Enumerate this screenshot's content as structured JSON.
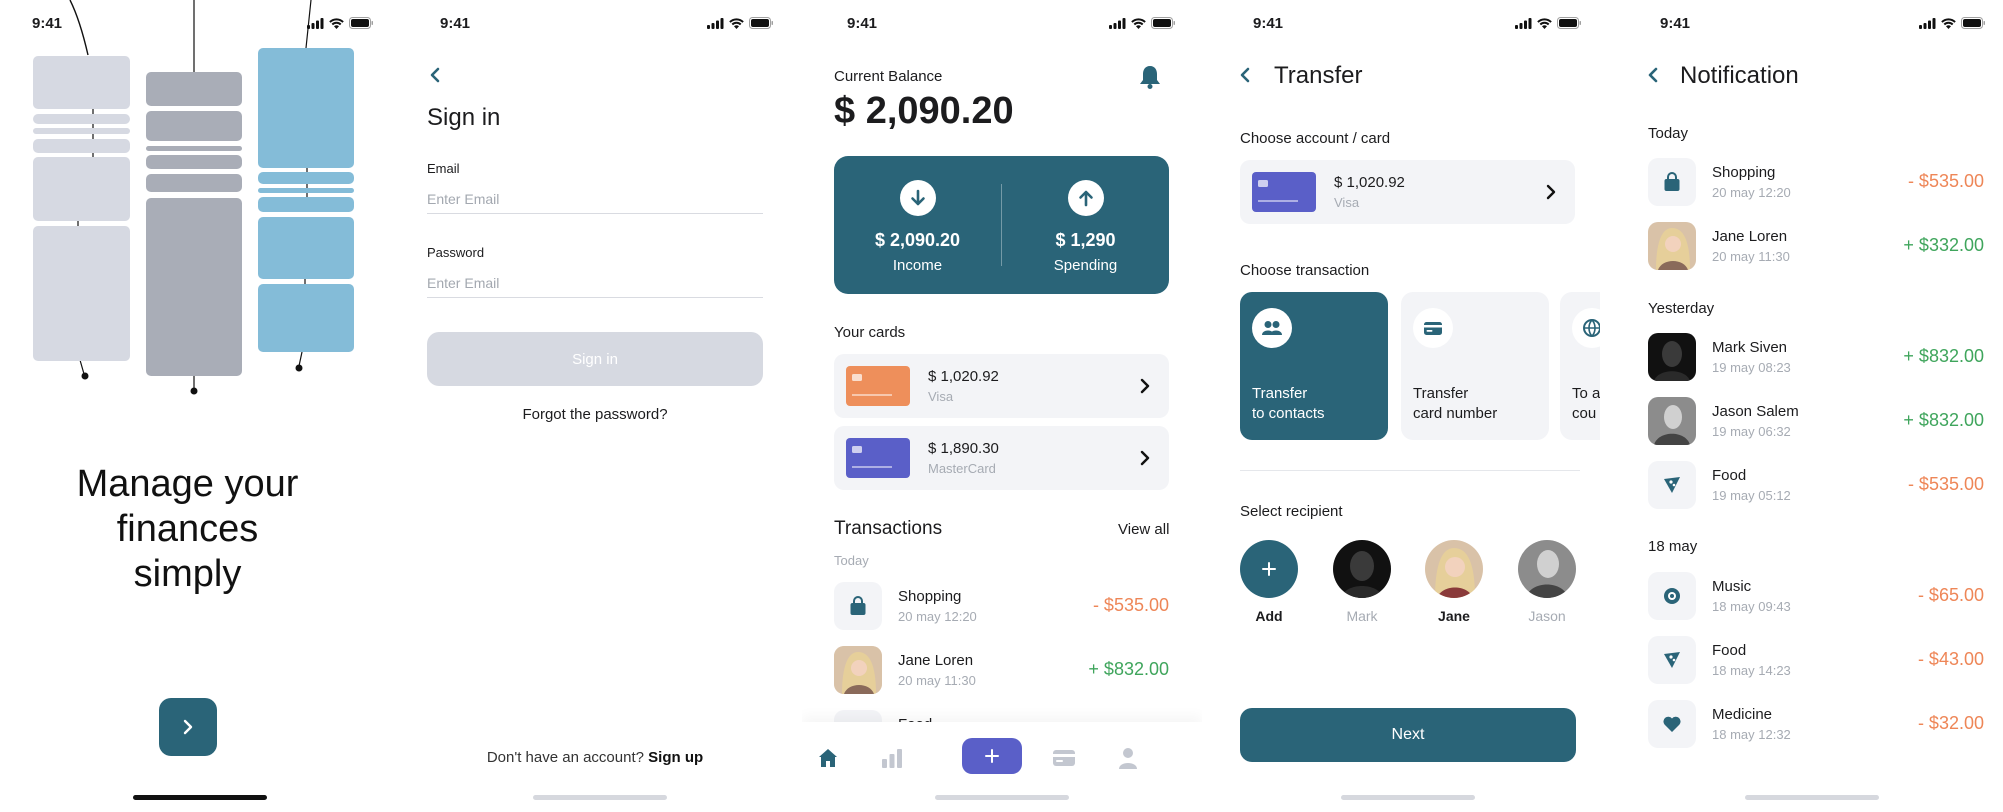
{
  "status_time": "9:41",
  "colors": {
    "primary": "#2a6478",
    "accent": "#5a5fc8",
    "negative": "#ee8657",
    "positive": "#3fa55c",
    "muted": "#a6abb3"
  },
  "onboarding": {
    "title_line1": "Manage your",
    "title_line2": "finances",
    "title_line3": "simply",
    "next_icon": "chevron-right-icon"
  },
  "signin": {
    "title": "Sign in",
    "email_label": "Email",
    "email_placeholder": "Enter Email",
    "password_label": "Password",
    "password_placeholder": "Enter Email",
    "button": "Sign in",
    "forgot": "Forgot the password?",
    "no_account": "Don't have an account?",
    "signup": "Sign up"
  },
  "home": {
    "balance_label": "Current Balance",
    "balance": "$ 2,090.20",
    "income_amount": "$ 2,090.20",
    "income_label": "Income",
    "spending_amount": "$ 1,290",
    "spending_label": "Spending",
    "cards_title": "Your cards",
    "cards": [
      {
        "amount": "$ 1,020.92",
        "type": "Visa"
      },
      {
        "amount": "$ 1,890.30",
        "type": "MasterCard"
      }
    ],
    "transactions_title": "Transactions",
    "view_all": "View all",
    "today_label": "Today",
    "transactions": [
      {
        "name": "Shopping",
        "date": "20 may 12:20",
        "value": "- $535.00"
      },
      {
        "name": "Jane Loren",
        "date": "20 may 11:30",
        "value": "+ $832.00"
      },
      {
        "name": "Food",
        "date": "",
        "value": ""
      }
    ]
  },
  "transfer": {
    "title": "Transfer",
    "choose_account": "Choose account / card",
    "account_amount": "$ 1,020.92",
    "account_type": "Visa",
    "choose_transaction": "Choose transaction",
    "options": [
      {
        "line1": "Transfer",
        "line2": "to contacts"
      },
      {
        "line1": "Transfer",
        "line2": "card number"
      },
      {
        "line1": "To a",
        "line2": "cou"
      }
    ],
    "select_recipient": "Select recipient",
    "recipients": [
      "Add",
      "Mark",
      "Jane",
      "Jason"
    ],
    "next": "Next"
  },
  "notification": {
    "title": "Notification",
    "groups": [
      {
        "label": "Today",
        "items": [
          {
            "name": "Shopping",
            "date": "20 may 12:20",
            "value": "- $535.00"
          },
          {
            "name": "Jane Loren",
            "date": "20 may 11:30",
            "value": "+ $332.00"
          }
        ]
      },
      {
        "label": "Yesterday",
        "items": [
          {
            "name": "Mark Siven",
            "date": "19 may 08:23",
            "value": "+ $832.00"
          },
          {
            "name": "Jason Salem",
            "date": "19 may 06:32",
            "value": "+ $832.00"
          },
          {
            "name": "Food",
            "date": "19 may 05:12",
            "value": "- $535.00"
          }
        ]
      },
      {
        "label": "18 may",
        "items": [
          {
            "name": "Music",
            "date": "18 may 09:43",
            "value": "- $65.00"
          },
          {
            "name": "Food",
            "date": "18 may 14:23",
            "value": "- $43.00"
          },
          {
            "name": "Medicine",
            "date": "18 may 12:32",
            "value": "- $32.00"
          }
        ]
      }
    ]
  }
}
